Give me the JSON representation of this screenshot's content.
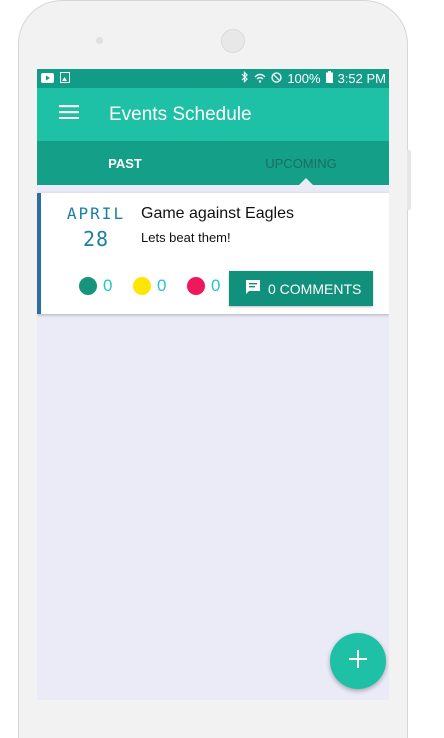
{
  "status_bar": {
    "battery": "100%",
    "time": "3:52 PM",
    "left_icons": [
      "youtube-icon",
      "image-icon"
    ],
    "right_icons": [
      "bluetooth-icon",
      "wifi-icon",
      "no-disturb-icon"
    ]
  },
  "app_bar": {
    "title": "Events Schedule",
    "menu_icon": "hamburger-menu-icon"
  },
  "tabs": [
    {
      "label": "PAST",
      "selected": true
    },
    {
      "label": "UPCOMING",
      "selected": false
    }
  ],
  "event": {
    "month": "APRIL",
    "day": "28",
    "title": "Game against Eagles",
    "description": "Lets beat them!",
    "rsvp": [
      {
        "color": "#16947c",
        "count": "0"
      },
      {
        "color": "#ffe600",
        "count": "0"
      },
      {
        "color": "#f0185c",
        "count": "0"
      }
    ],
    "comments_label": "0 COMMENTS"
  },
  "fab": {
    "icon": "plus-icon"
  },
  "colors": {
    "status_bar": "#129c87",
    "app_bar": "#1ec0a6",
    "tab_bar": "#14a088",
    "button": "#11917c",
    "background": "#eaebf7",
    "date_text": "#1a7fa3"
  }
}
